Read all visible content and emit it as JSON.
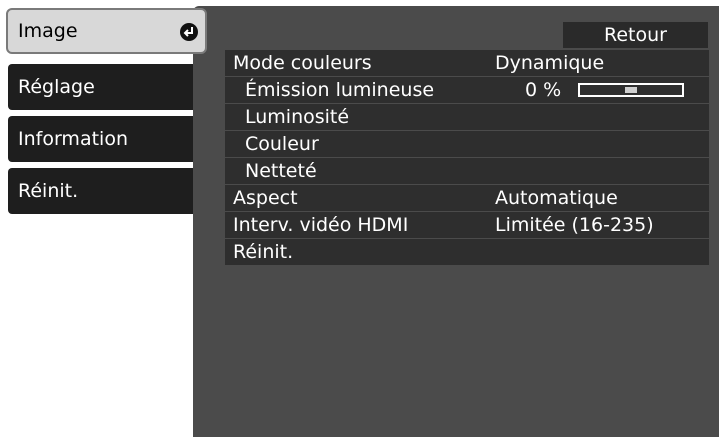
{
  "tabs": [
    {
      "label": "Image",
      "active": true,
      "icon": "enter-icon"
    },
    {
      "label": "Réglage",
      "active": false
    },
    {
      "label": "Information",
      "active": false
    },
    {
      "label": "Réinit.",
      "active": false
    }
  ],
  "back_label": "Retour",
  "menu": {
    "mode_couleurs": {
      "label": "Mode couleurs",
      "value": "Dynamique"
    },
    "emission": {
      "label": "Émission lumineuse",
      "value": "0 %",
      "level": 0.5
    },
    "luminosite": {
      "label": "Luminosité"
    },
    "couleur": {
      "label": "Couleur"
    },
    "nettete": {
      "label": "Netteté"
    },
    "aspect": {
      "label": "Aspect",
      "value": "Automatique"
    },
    "hdmi": {
      "label": "Interv. vidéo HDMI",
      "value": "Limitée (16-235)"
    },
    "reinit": {
      "label": "Réinit."
    }
  },
  "colors": {
    "panel": "#4b4b4b",
    "row": "#2e2e2e",
    "tab": "#1e1e1e",
    "active_tab": "#d8d8d8"
  }
}
